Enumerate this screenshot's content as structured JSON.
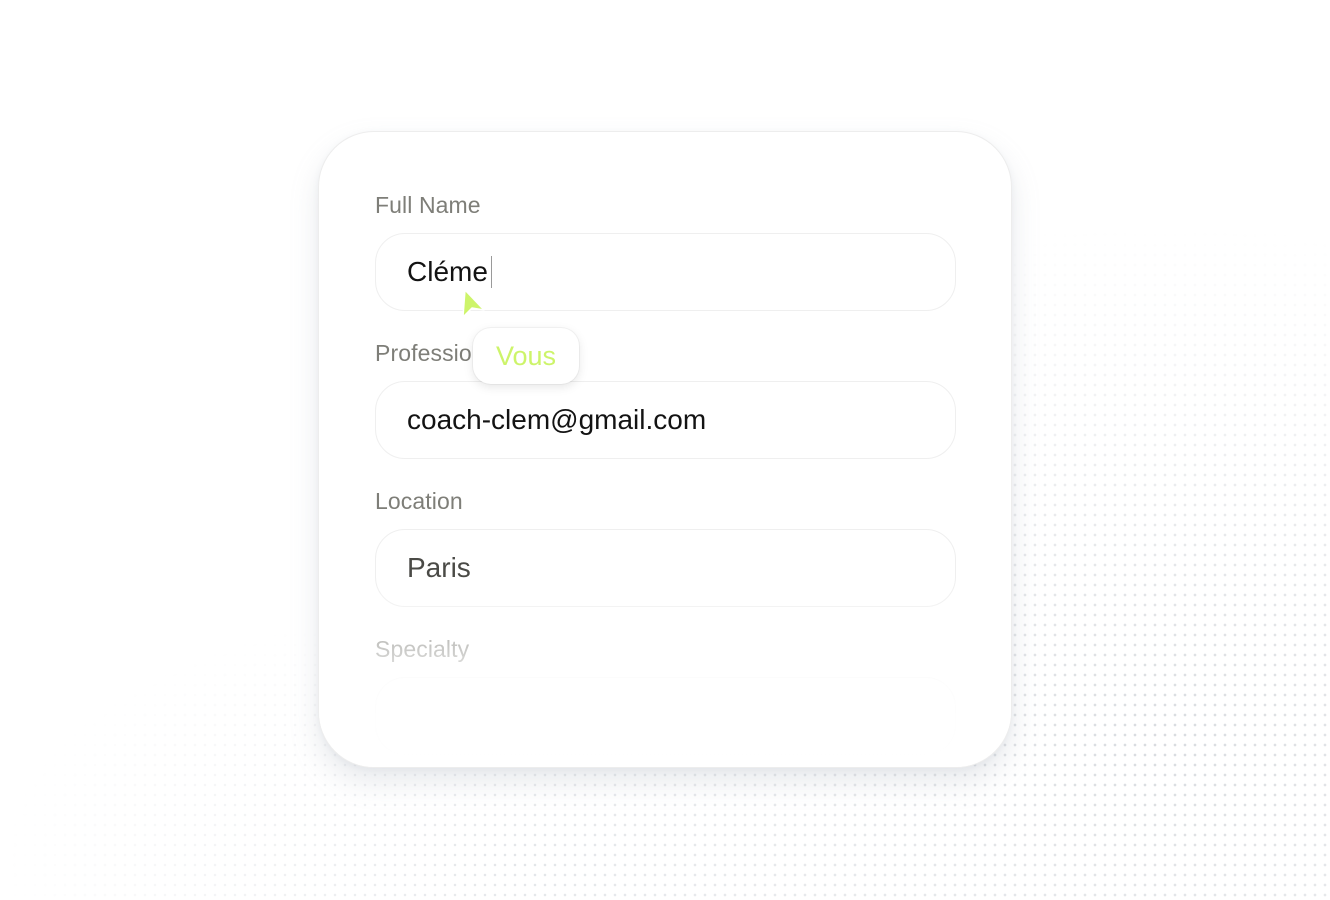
{
  "form": {
    "full_name": {
      "label": "Full Name",
      "value": "Cléme"
    },
    "professional_email": {
      "label": "Professio",
      "value": "coach-clem@gmail.com"
    },
    "location": {
      "label": "Location",
      "value": "Paris"
    },
    "specialty": {
      "label": "Specialty",
      "value": ""
    }
  },
  "cursor": {
    "tag_label": "Vous",
    "color": "#cdf46a"
  },
  "icons": {
    "pointer": "cursor-arrow-icon"
  }
}
